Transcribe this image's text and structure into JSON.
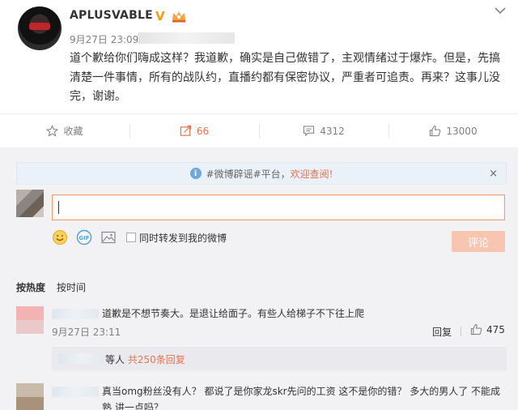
{
  "post": {
    "username": "APLUSVABLE",
    "verified_badge": "V",
    "crown_icon": "crown-badge-icon",
    "time": "9月27日 23:09",
    "text": "道个歉给你们嗨成这样？我道歉，确实是自己做错了，主观情绪过于爆炸。但是，先搞清楚一件事情，所有的战队约，直播约都有保密协议，严重者可追责。再来？这事儿没完，谢谢。"
  },
  "actions": {
    "favorite_label": "收藏",
    "repost_count": "66",
    "comment_count": "4312",
    "like_count": "13000"
  },
  "comments_area": {
    "notice_prefix": "#微博辟谣#平台，",
    "notice_link": "欢迎查阅!",
    "notice_close": "×",
    "input_value": "",
    "checkbox_label": "同时转发到我的微博",
    "submit_label": "评论",
    "sort_hot": "按热度",
    "sort_time": "按时间"
  },
  "comments": [
    {
      "text": "道歉是不想节奏大。是退让给面子。有些人给梯子不下往上爬",
      "time": "9月27日 23:11",
      "reply_label": "回复",
      "likes": "475",
      "subreply_prefix": "等人",
      "subreply_count": "共250条回复"
    },
    {
      "text": "真当omg粉丝没有人？ 都说了是你家龙skr先问的工资 这不是你的错？ 多大的男人了 不能成熟 讲一点吗？"
    }
  ],
  "colors": {
    "accent": "#eb7350",
    "link_blue": "#6fa7dc",
    "page_bg": "#f2f2f5",
    "verified": "#f59d19"
  }
}
